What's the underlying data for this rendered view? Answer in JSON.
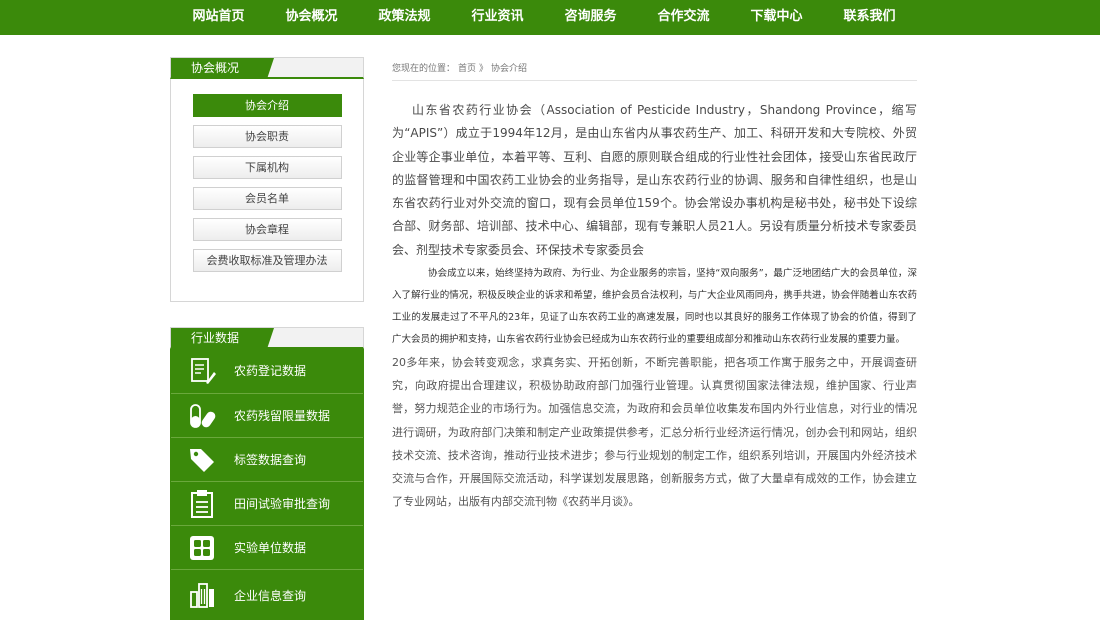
{
  "nav": {
    "items": [
      "网站首页",
      "协会概况",
      "政策法规",
      "行业资讯",
      "咨询服务",
      "合作交流",
      "下载中心",
      "联系我们"
    ]
  },
  "sidebar": {
    "about_title": "协会概况",
    "about_items": [
      {
        "label": "协会介绍",
        "active": true
      },
      {
        "label": "协会职责",
        "active": false
      },
      {
        "label": "下属机构",
        "active": false
      },
      {
        "label": "会员名单",
        "active": false
      },
      {
        "label": "协会章程",
        "active": false
      },
      {
        "label": "会费收取标准及管理办法",
        "active": false
      }
    ],
    "data_title": "行业数据",
    "data_items": [
      {
        "label": "农药登记数据",
        "icon": "document-pen-icon"
      },
      {
        "label": "农药残留限量数据",
        "icon": "pills-icon"
      },
      {
        "label": "标签数据查询",
        "icon": "tag-icon"
      },
      {
        "label": "田间试验审批查询",
        "icon": "clipboard-icon"
      },
      {
        "label": "实验单位数据",
        "icon": "grid-blocks-icon"
      },
      {
        "label": "企业信息查询",
        "icon": "buildings-icon"
      }
    ]
  },
  "breadcrumb": {
    "prefix": "您现在的位置：",
    "home": "首页",
    "separator": "》",
    "current": "协会介绍"
  },
  "article": {
    "p1": "山东省农药行业协会（Association of Pesticide Industry，Shandong Province，缩写为“APIS”）成立于1994年12月，是由山东省内从事农药生产、加工、科研开发和大专院校、外贸企业等企事业单位，本着平等、互利、自愿的原则联合组成的行业性社会团体，接受山东省民政厅的监督管理和中国农药工业协会的业务指导，是山东农药行业的协调、服务和自律性组织，也是山东省农药行业对外交流的窗口，现有会员单位159个。协会常设办事机构是秘书处，秘书处下设综合部、财务部、培训部、技术中心、编辑部，现有专兼职人员21人。另设有质量分析技术专家委员会、剂型技术专家委员会、环保技术专家委员会",
    "p2": "协会成立以来，始终坚持为政府、为行业、为企业服务的宗旨，坚持“双向服务”，最广泛地团结广大的会员单位，深入了解行业的情况，积极反映企业的诉求和希望，维护会员合法权利，与广大企业风雨同舟，携手共进，协会伴随着山东农药工业的发展走过了不平凡的23年，见证了山东农药工业的高速发展，同时也以其良好的服务工作体现了协会的价值，得到了广大会员的拥护和支持，山东省农药行业协会已经成为山东农药行业的重要组成部分和推动山东农药行业发展的重要力量。",
    "p3": "20多年来，协会转变观念，求真务实、开拓创新，不断完善职能，把各项工作寓于服务之中，开展调查研究，向政府提出合理建议，积极协助政府部门加强行业管理。认真贯彻国家法律法规，维护国家、行业声誉，努力规范企业的市场行为。加强信息交流，为政府和会员单位收集发布国内外行业信息，对行业的情况进行调研，为政府部门决策和制定产业政策提供参考，汇总分析行业经济运行情况，创办会刊和网站，组织技术交流、技术咨询，推动行业技术进步；参与行业规划的制定工作，组织系列培训，开展国内外经济技术交流与合作，开展国际交流活动，科学谋划发展思路，创新服务方式，做了大量卓有成效的工作，协会建立了专业网站，出版有内部交流刊物《农药半月谈》。"
  },
  "colors": {
    "brand_green": "#3b8a0b"
  }
}
